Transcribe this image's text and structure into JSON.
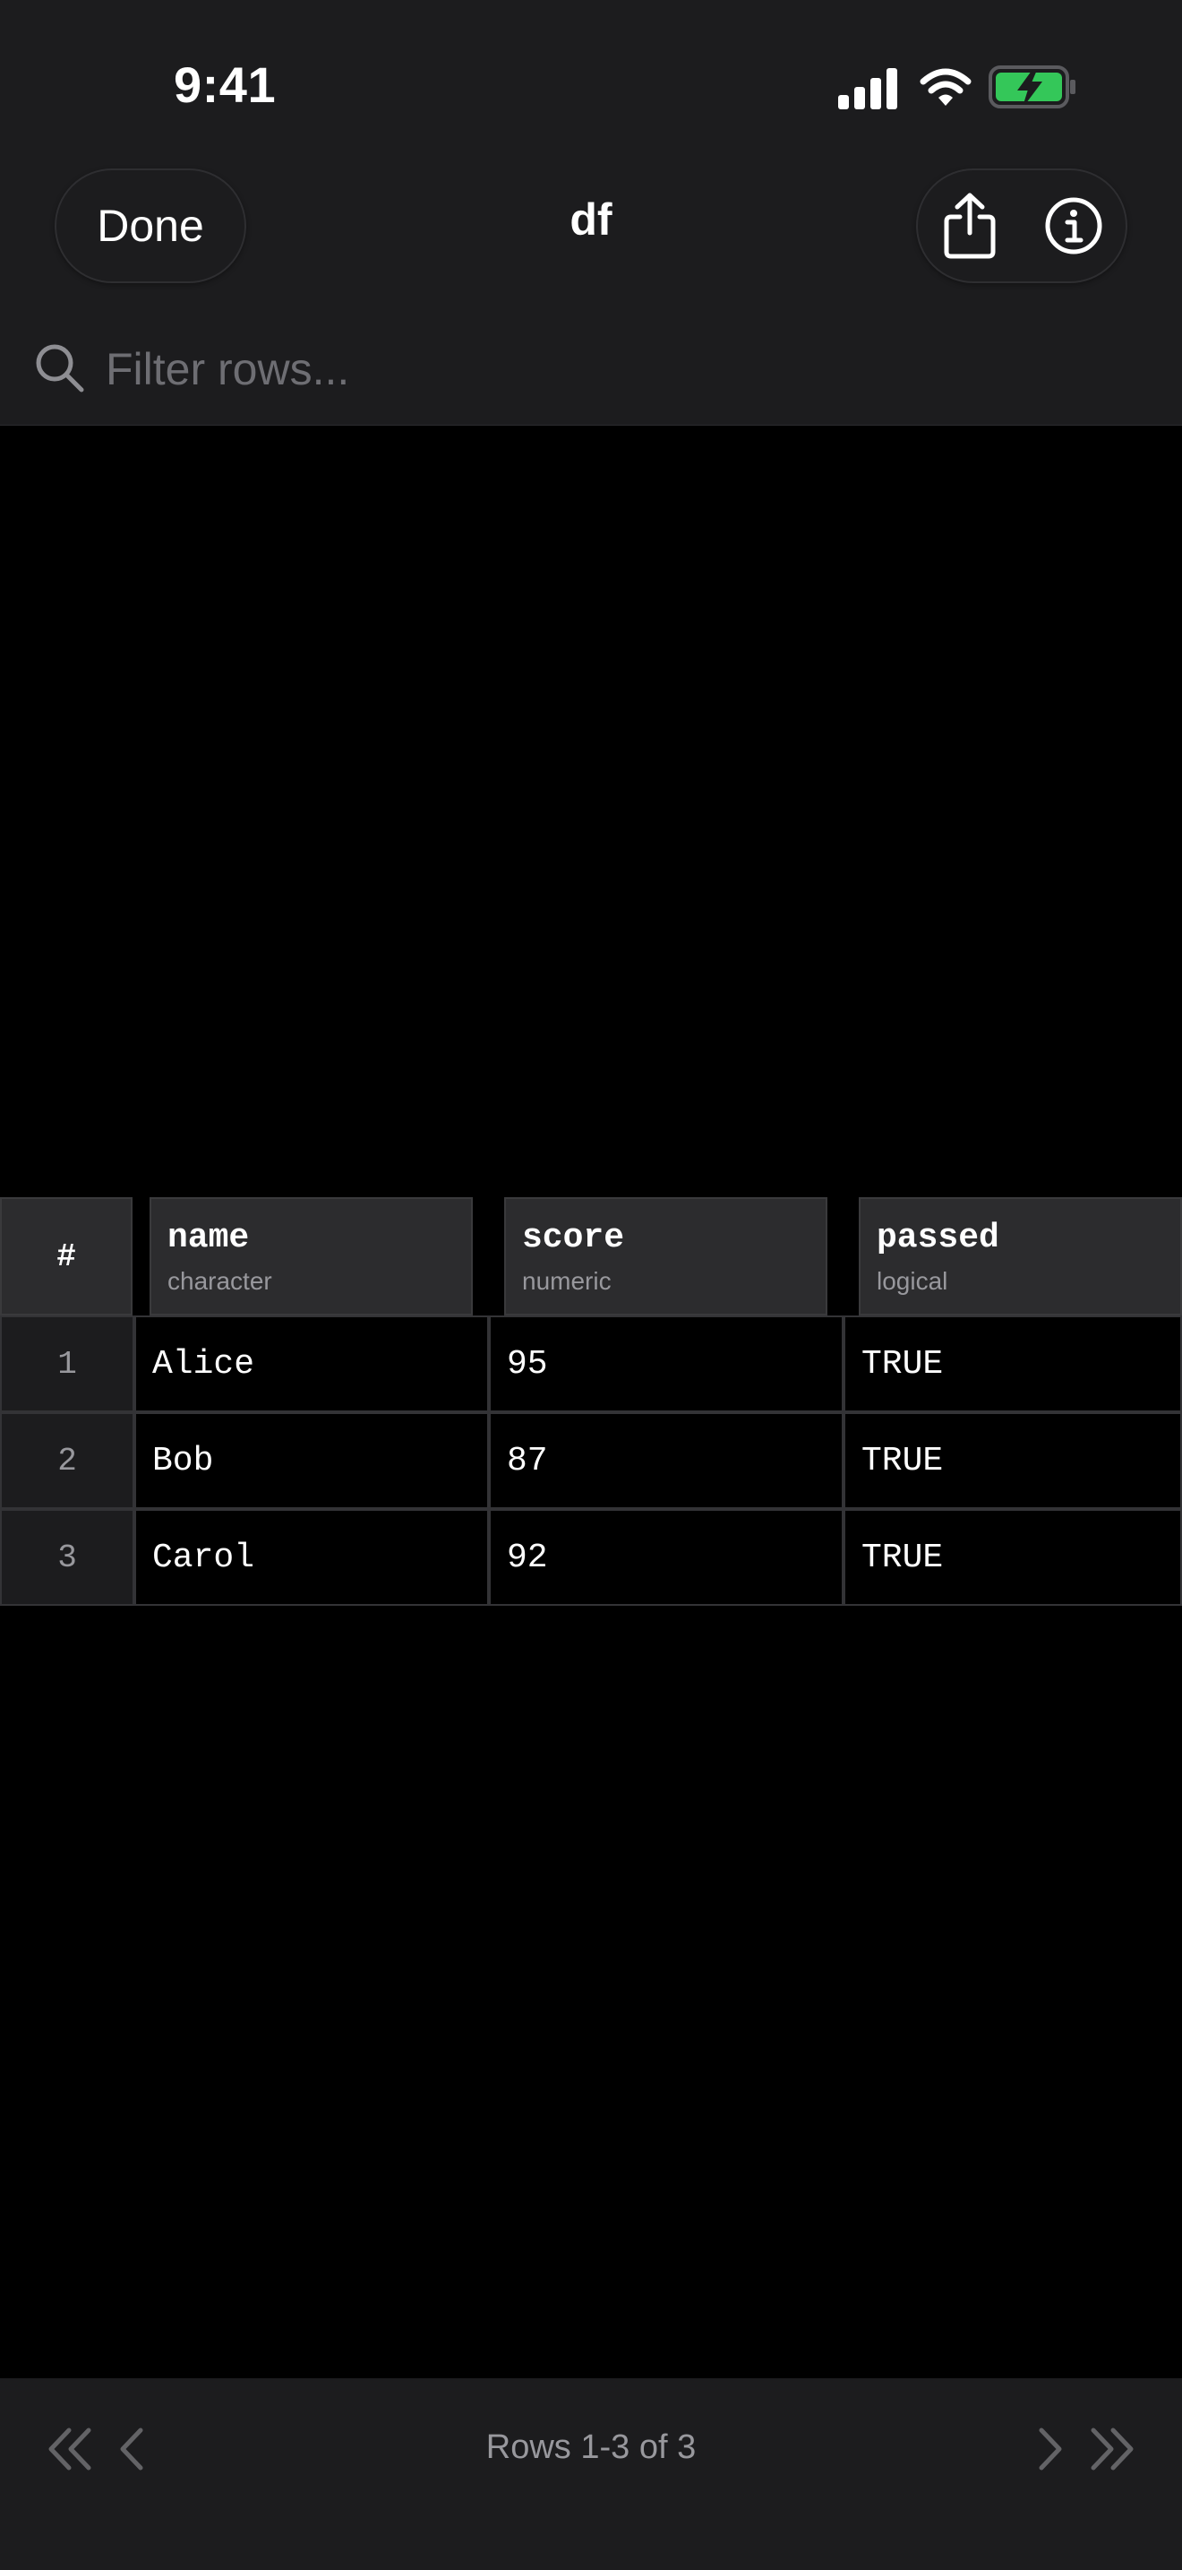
{
  "status_bar": {
    "time": "9:41",
    "icons": [
      "cellular-signal-icon",
      "wifi-icon",
      "battery-charging-icon"
    ],
    "battery_color": "#34c759"
  },
  "nav": {
    "done_label": "Done",
    "title": "df",
    "actions": [
      "share-icon",
      "info-icon"
    ]
  },
  "search": {
    "placeholder": "Filter rows...",
    "value": ""
  },
  "table": {
    "index_header": "#",
    "columns": [
      {
        "name": "name",
        "type": "character"
      },
      {
        "name": "score",
        "type": "numeric"
      },
      {
        "name": "passed",
        "type": "logical"
      }
    ],
    "rows": [
      {
        "index": "1",
        "cells": [
          "Alice",
          "95",
          "TRUE"
        ]
      },
      {
        "index": "2",
        "cells": [
          "Bob",
          "87",
          "TRUE"
        ]
      },
      {
        "index": "3",
        "cells": [
          "Carol",
          "92",
          "TRUE"
        ]
      }
    ]
  },
  "pager": {
    "label": "Rows 1-3 of 3",
    "buttons": [
      "first-page-icon",
      "previous-page-icon",
      "next-page-icon",
      "last-page-icon"
    ]
  },
  "colors": {
    "background": "#000000",
    "chrome": "#1c1c1e",
    "header_cell": "#2c2c2e",
    "muted_text": "#98989d"
  }
}
